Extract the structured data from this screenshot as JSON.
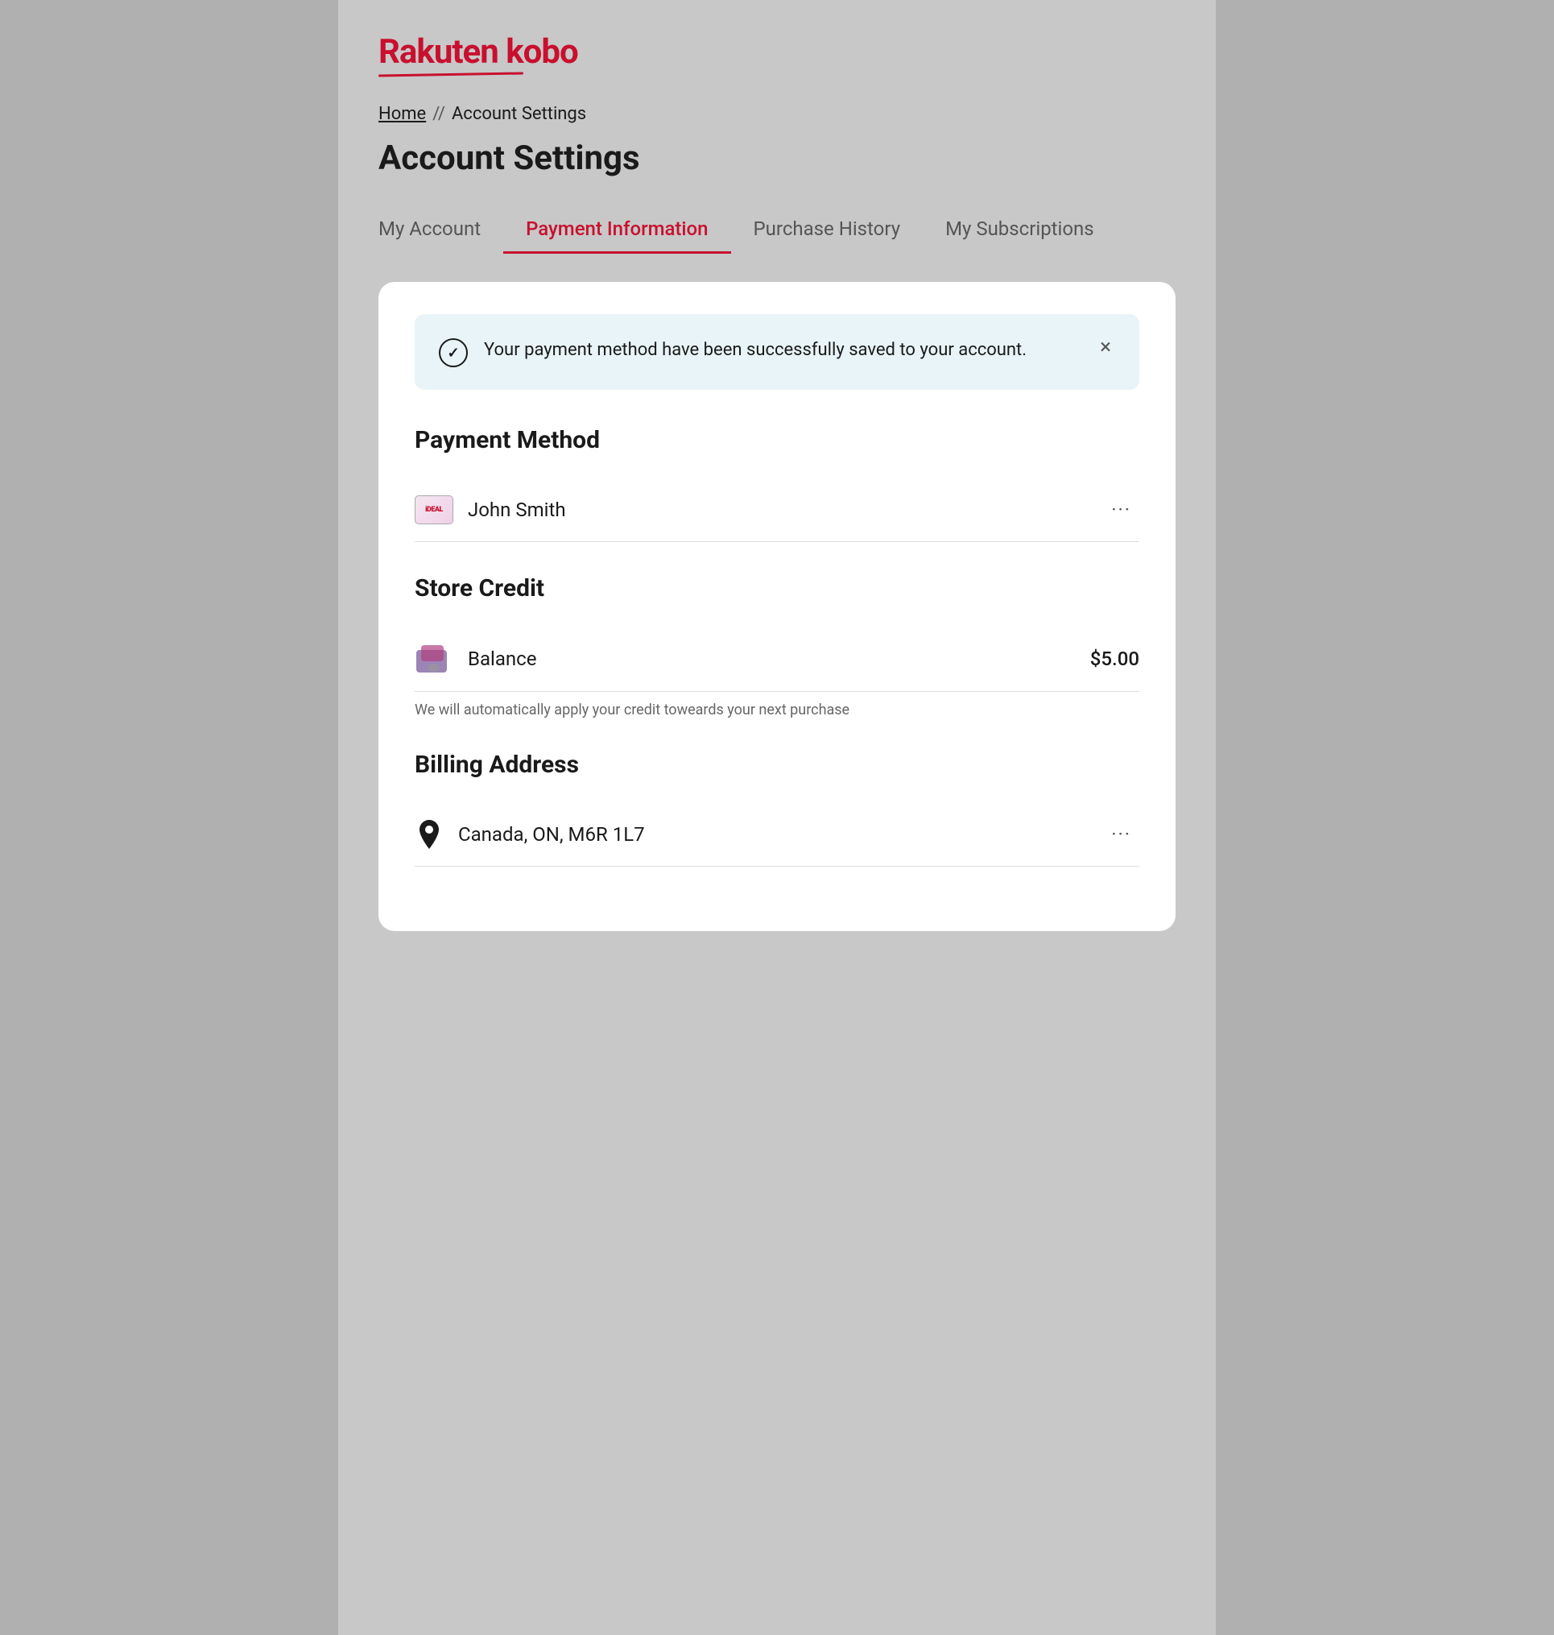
{
  "logo": {
    "text": "Rakuten kobo"
  },
  "breadcrumb": {
    "home_label": "Home",
    "separator": "//",
    "current_label": "Account Settings"
  },
  "page_title": "Account Settings",
  "tabs": [
    {
      "id": "my-account",
      "label": "My Account",
      "active": false
    },
    {
      "id": "payment-information",
      "label": "Payment Information",
      "active": true
    },
    {
      "id": "purchase-history",
      "label": "Purchase History",
      "active": false
    },
    {
      "id": "my-subscriptions",
      "label": "My Subscriptions",
      "active": false
    }
  ],
  "alert": {
    "message": "Your payment method have been successfully saved to your account.",
    "close_label": "×"
  },
  "payment_method": {
    "section_title": "Payment Method",
    "items": [
      {
        "icon_label": "iDEAL",
        "name": "John Smith",
        "more_options": "···"
      }
    ]
  },
  "store_credit": {
    "section_title": "Store Credit",
    "label": "Balance",
    "amount": "$5.00",
    "note": "We will automatically apply your credit toweards your next purchase",
    "more_options": "···"
  },
  "billing_address": {
    "section_title": "Billing Address",
    "items": [
      {
        "address": "Canada, ON, M6R 1L7",
        "more_options": "···"
      }
    ]
  }
}
